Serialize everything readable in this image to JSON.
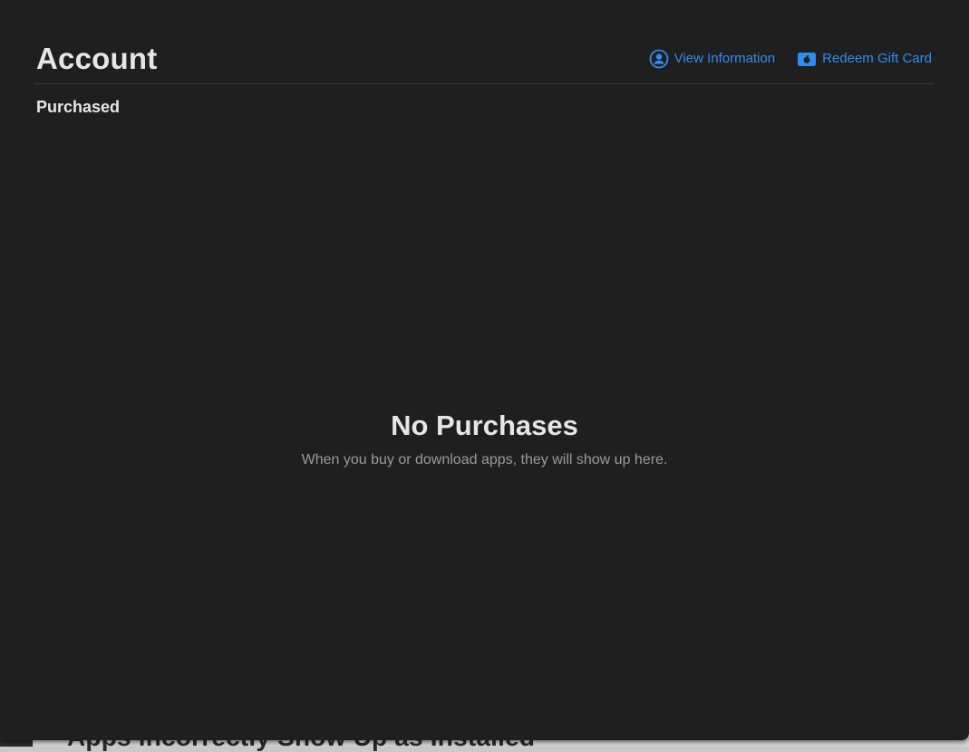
{
  "background": {
    "partial_text": "Apps incorrectly Show Up as Installed"
  },
  "header": {
    "title": "Account",
    "actions": [
      {
        "label": "View Information",
        "icon": "person-circle-icon"
      },
      {
        "label": "Redeem Gift Card",
        "icon": "gift-card-icon"
      }
    ]
  },
  "section": {
    "label": "Purchased"
  },
  "empty_state": {
    "title": "No Purchases",
    "subtitle": "When you buy or download apps, they will show up here."
  },
  "colors": {
    "window_bg": "#1f1f1f",
    "accent": "#2f8cf0",
    "text_primary": "#e6e6e6",
    "text_secondary": "#9a9a9a"
  }
}
